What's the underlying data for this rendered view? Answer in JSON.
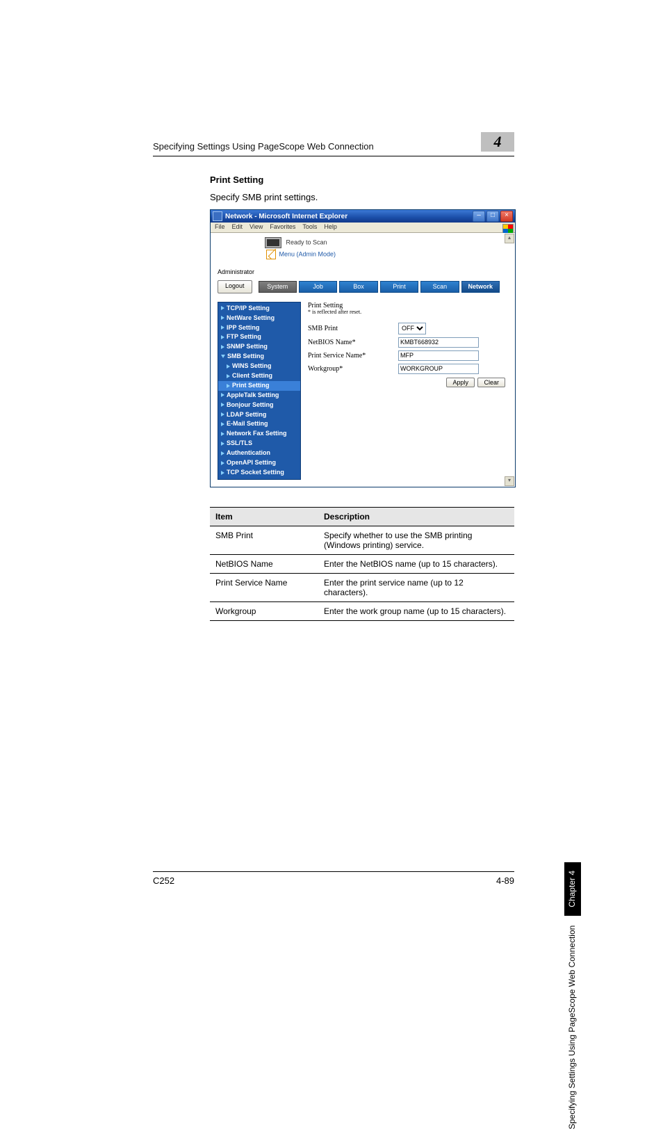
{
  "running_head": "Specifying Settings Using PageScope Web Connection",
  "chapter_num": "4",
  "section": {
    "title": "Print Setting",
    "body": "Specify SMB print settings."
  },
  "ie": {
    "title": "Network - Microsoft Internet Explorer",
    "menus": [
      "File",
      "Edit",
      "View",
      "Favorites",
      "Tools",
      "Help"
    ],
    "status_text": "Ready to Scan",
    "menu_mode": "Menu (Admin Mode)",
    "admin_label": "Administrator",
    "logout": "Logout",
    "tabs": [
      "System",
      "Job",
      "Box",
      "Print",
      "Scan",
      "Network"
    ]
  },
  "nav": [
    {
      "label": "TCP/IP Setting"
    },
    {
      "label": "NetWare Setting"
    },
    {
      "label": "IPP Setting"
    },
    {
      "label": "FTP Setting"
    },
    {
      "label": "SNMP Setting"
    },
    {
      "label": "SMB Setting",
      "expanded": true,
      "children": [
        {
          "label": "WINS Setting"
        },
        {
          "label": "Client Setting"
        },
        {
          "label": "Print Setting",
          "highlight": true
        }
      ]
    },
    {
      "label": "AppleTalk Setting"
    },
    {
      "label": "Bonjour Setting"
    },
    {
      "label": "LDAP Setting"
    },
    {
      "label": "E-Mail Setting"
    },
    {
      "label": "Network Fax Setting"
    },
    {
      "label": "SSL/TLS"
    },
    {
      "label": "Authentication"
    },
    {
      "label": "OpenAPI Setting"
    },
    {
      "label": "TCP Socket Setting"
    }
  ],
  "panel": {
    "title": "Print Setting",
    "note": "* is reflected after reset.",
    "fields": {
      "smb_print_label": "SMB Print",
      "smb_print_value": "OFF",
      "netbios_label": "NetBIOS Name*",
      "netbios_value": "KMBT668932",
      "print_service_label": "Print Service Name*",
      "print_service_value": "MFP",
      "workgroup_label": "Workgroup*",
      "workgroup_value": "WORKGROUP"
    },
    "apply": "Apply",
    "clear": "Clear"
  },
  "table": {
    "head_item": "Item",
    "head_desc": "Description",
    "rows": [
      {
        "item": "SMB Print",
        "desc": "Specify whether to use the SMB printing (Windows printing) service."
      },
      {
        "item": "NetBIOS Name",
        "desc": "Enter the NetBIOS name (up to 15 characters)."
      },
      {
        "item": "Print Service Name",
        "desc": "Enter the print service name (up to 12 characters)."
      },
      {
        "item": "Workgroup",
        "desc": "Enter the work group name (up to 15 characters)."
      }
    ]
  },
  "side_tab": {
    "label": "Specifying Settings Using PageScope Web Connection",
    "chapter": "Chapter 4"
  },
  "footer": {
    "left": "C252",
    "right": "4-89"
  }
}
